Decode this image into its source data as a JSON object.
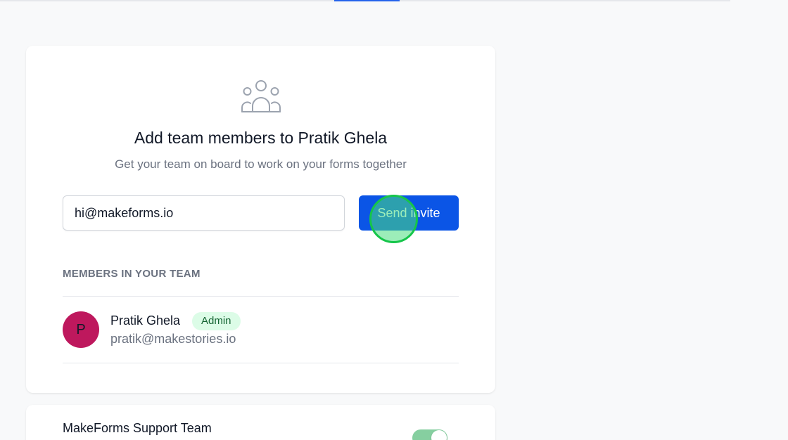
{
  "card": {
    "title": "Add team members to Pratik Ghela",
    "subtitle": "Get your team on board to work on your forms together",
    "icon": "users-group-icon",
    "invite": {
      "email_value": "hi@makeforms.io",
      "send_label": "Send invite"
    },
    "members_heading": "MEMBERS IN YOUR TEAM",
    "members": [
      {
        "initial": "P",
        "name": "Pratik Ghela",
        "role": "Admin",
        "email": "pratik@makestories.io",
        "avatar_color": "#be185d"
      }
    ]
  },
  "support_card": {
    "title": "MakeForms Support Team",
    "toggle_on": true
  },
  "colors": {
    "accent": "#0b55e6",
    "badge_bg": "#dcfce7",
    "badge_text": "#166534"
  }
}
